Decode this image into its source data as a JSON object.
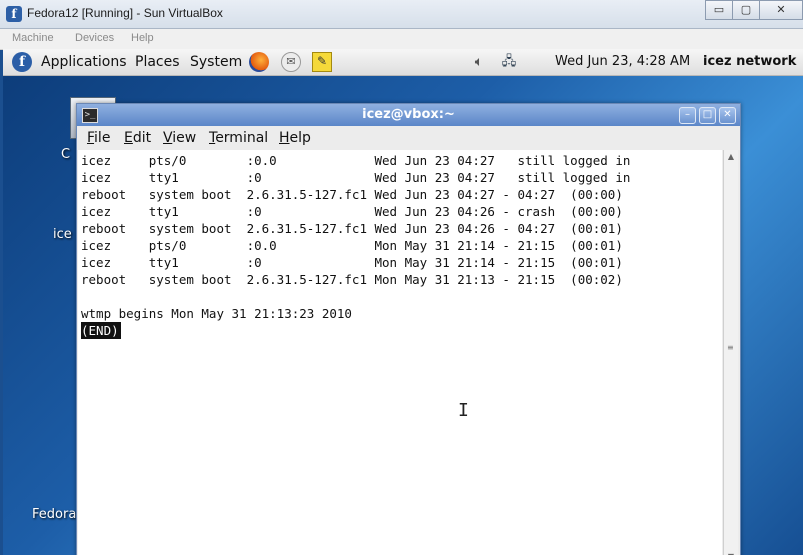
{
  "vbox": {
    "title": "Fedora12 [Running] - Sun VirtualBox",
    "menu": [
      "Machine",
      "Devices",
      "Help"
    ],
    "ctrl_min": "▭",
    "ctrl_max": "▢",
    "ctrl_close": "✕"
  },
  "panel": {
    "menus": [
      "Applications",
      "Places",
      "System"
    ],
    "clock": "Wed Jun 23,  4:28 AM",
    "network": "icez network"
  },
  "desktop": {
    "labels": [
      "C",
      "ice",
      "Fedora"
    ]
  },
  "terminal": {
    "title": "icez@vbox:~",
    "menu": [
      {
        "letter": "F",
        "rest": "ile"
      },
      {
        "letter": "E",
        "rest": "dit"
      },
      {
        "letter": "V",
        "rest": "iew"
      },
      {
        "letter": "T",
        "rest": "erminal"
      },
      {
        "letter": "H",
        "rest": "elp"
      }
    ],
    "output": "icez     pts/0        :0.0             Wed Jun 23 04:27   still logged in\nicez     tty1         :0               Wed Jun 23 04:27   still logged in\nreboot   system boot  2.6.31.5-127.fc1 Wed Jun 23 04:27 - 04:27  (00:00)\nicez     tty1         :0               Wed Jun 23 04:26 - crash  (00:00)\nreboot   system boot  2.6.31.5-127.fc1 Wed Jun 23 04:26 - 04:27  (00:01)\nicez     pts/0        :0.0             Mon May 31 21:14 - 21:15  (00:01)\nicez     tty1         :0               Mon May 31 21:14 - 21:15  (00:01)\nreboot   system boot  2.6.31.5-127.fc1 Mon May 31 21:13 - 21:15  (00:02)\n\nwtmp begins Mon May 31 21:13:23 2010",
    "end_marker": "(END)"
  },
  "icons": [
    "fedora-icon",
    "firefox-icon",
    "mail-icon",
    "notes-icon",
    "volume-icon",
    "network-icon",
    "terminal-icon"
  ]
}
